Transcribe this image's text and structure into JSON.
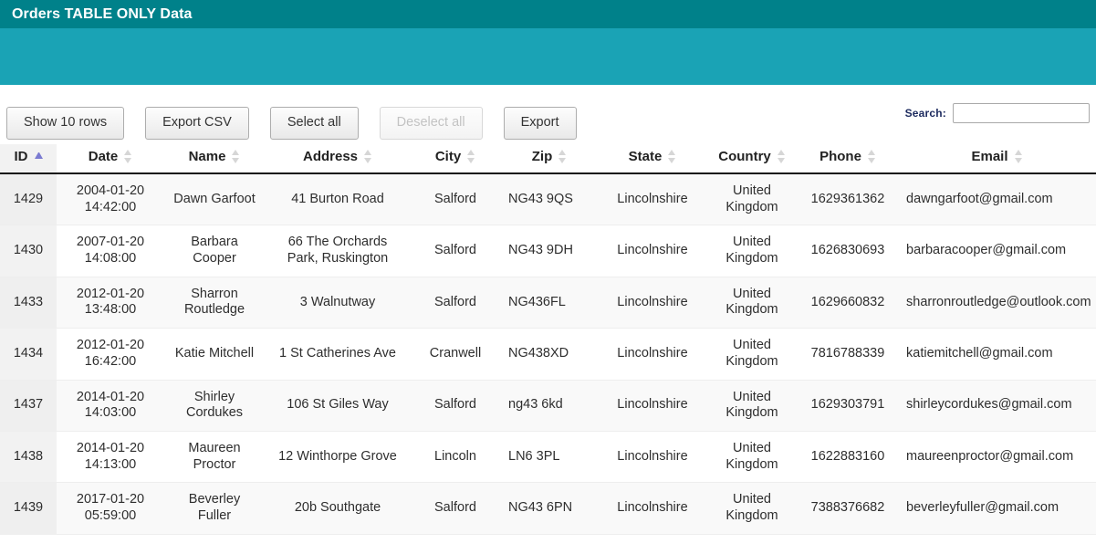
{
  "banner": {
    "title": "Orders TABLE ONLY Data"
  },
  "toolbar": {
    "buttons": [
      {
        "label": "Show 10 rows",
        "name": "show-rows-button",
        "disabled": false
      },
      {
        "label": "Export CSV",
        "name": "export-csv-button",
        "disabled": false
      },
      {
        "label": "Select all",
        "name": "select-all-button",
        "disabled": false
      },
      {
        "label": "Deselect all",
        "name": "deselect-all-button",
        "disabled": true
      },
      {
        "label": "Export",
        "name": "export-button",
        "disabled": false
      }
    ],
    "search_label": "Search:",
    "search_value": "",
    "search_placeholder": ""
  },
  "table": {
    "columns": [
      {
        "key": "id",
        "label": "ID",
        "sort": "asc",
        "align": "center"
      },
      {
        "key": "date",
        "label": "Date",
        "sort": "both",
        "align": "center"
      },
      {
        "key": "name",
        "label": "Name",
        "sort": "both",
        "align": "center"
      },
      {
        "key": "address",
        "label": "Address",
        "sort": "both",
        "align": "center"
      },
      {
        "key": "city",
        "label": "City",
        "sort": "both",
        "align": "center"
      },
      {
        "key": "zip",
        "label": "Zip",
        "sort": "both",
        "align": "center"
      },
      {
        "key": "state",
        "label": "State",
        "sort": "both",
        "align": "center"
      },
      {
        "key": "country",
        "label": "Country",
        "sort": "both",
        "align": "center"
      },
      {
        "key": "phone",
        "label": "Phone",
        "sort": "both",
        "align": "center"
      },
      {
        "key": "email",
        "label": "Email",
        "sort": "both",
        "align": "center"
      }
    ],
    "rows": [
      {
        "id": "1429",
        "date": "2004-01-20 14:42:00",
        "name": "Dawn Garfoot",
        "address": "41 Burton Road",
        "city": "Salford",
        "zip": "NG43 9QS",
        "state": "Lincolnshire",
        "country": "United Kingdom",
        "phone": "1629361362",
        "email": "dawngarfoot@gmail.com"
      },
      {
        "id": "1430",
        "date": "2007-01-20 14:08:00",
        "name": "Barbara Cooper",
        "address": "66 The Orchards Park, Ruskington",
        "city": "Salford",
        "zip": "NG43 9DH",
        "state": "Lincolnshire",
        "country": "United Kingdom",
        "phone": "1626830693",
        "email": "barbaracooper@gmail.com"
      },
      {
        "id": "1433",
        "date": "2012-01-20 13:48:00",
        "name": "Sharron Routledge",
        "address": "3 Walnutway",
        "city": "Salford",
        "zip": "NG436FL",
        "state": "Lincolnshire",
        "country": "United Kingdom",
        "phone": "1629660832",
        "email": "sharronroutledge@outlook.com"
      },
      {
        "id": "1434",
        "date": "2012-01-20 16:42:00",
        "name": "Katie Mitchell",
        "address": "1 St Catherines Ave",
        "city": "Cranwell",
        "zip": "NG438XD",
        "state": "Lincolnshire",
        "country": "United Kingdom",
        "phone": "7816788339",
        "email": "katiemitchell@gmail.com"
      },
      {
        "id": "1437",
        "date": "2014-01-20 14:03:00",
        "name": "Shirley Cordukes",
        "address": "106 St Giles Way",
        "city": "Salford",
        "zip": "ng43 6kd",
        "state": "Lincolnshire",
        "country": "United Kingdom",
        "phone": "1629303791",
        "email": "shirleycordukes@gmail.com"
      },
      {
        "id": "1438",
        "date": "2014-01-20 14:13:00",
        "name": "Maureen Proctor",
        "address": "12 Winthorpe Grove",
        "city": "Lincoln",
        "zip": "LN6 3PL",
        "state": "Lincolnshire",
        "country": "United Kingdom",
        "phone": "1622883160",
        "email": "maureenproctor@gmail.com"
      },
      {
        "id": "1439",
        "date": "2017-01-20 05:59:00",
        "name": "Beverley Fuller",
        "address": "20b Southgate",
        "city": "Salford",
        "zip": "NG43 6PN",
        "state": "Lincolnshire",
        "country": "United Kingdom",
        "phone": "7388376682",
        "email": "beverleyfuller@gmail.com"
      }
    ]
  },
  "colors": {
    "banner_top": "#00818a",
    "banner_body": "#1aa3b5",
    "sort_active": "#7b7bd1",
    "search_label": "#1c2a5e"
  }
}
